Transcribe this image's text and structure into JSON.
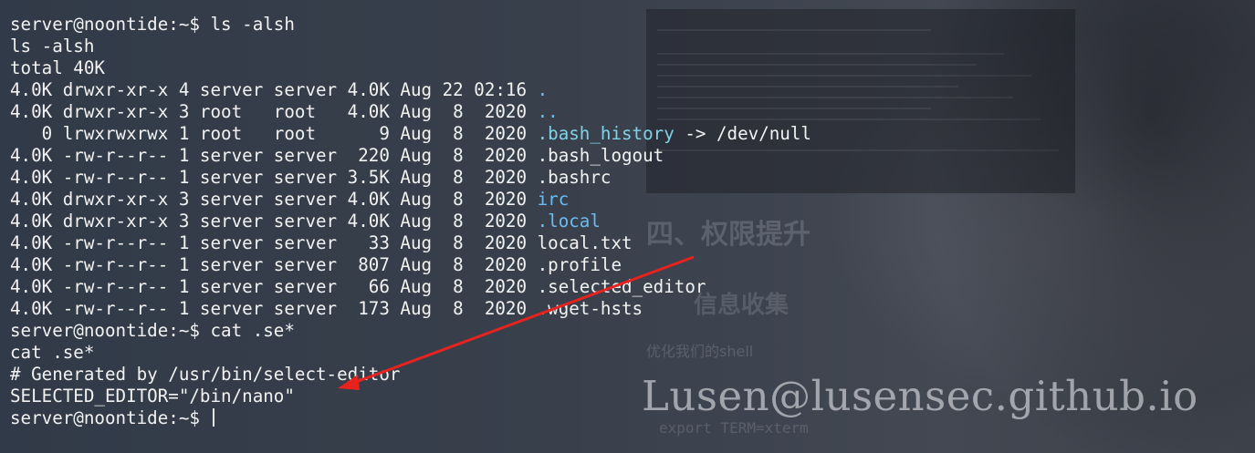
{
  "terminal": {
    "lines": [
      {
        "segments": [
          {
            "text": "server@noontide:~$ ls -alsh",
            "kind": "plain"
          }
        ]
      },
      {
        "segments": [
          {
            "text": "ls -alsh",
            "kind": "plain"
          }
        ]
      },
      {
        "segments": [
          {
            "text": "total 40K",
            "kind": "plain"
          }
        ]
      },
      {
        "segments": [
          {
            "text": "4.0K drwxr-xr-x 4 server server 4.0K Aug 22 02:16 ",
            "kind": "plain"
          },
          {
            "text": ".",
            "kind": "dir"
          }
        ]
      },
      {
        "segments": [
          {
            "text": "4.0K drwxr-xr-x 3 root   root   4.0K Aug  8  2020 ",
            "kind": "plain"
          },
          {
            "text": "..",
            "kind": "dir"
          }
        ]
      },
      {
        "segments": [
          {
            "text": "   0 lrwxrwxrwx 1 root   root      9 Aug  8  2020 ",
            "kind": "plain"
          },
          {
            "text": ".bash_history",
            "kind": "link"
          },
          {
            "text": " -> /dev/null",
            "kind": "plain"
          }
        ]
      },
      {
        "segments": [
          {
            "text": "4.0K -rw-r--r-- 1 server server  220 Aug  8  2020 .bash_logout",
            "kind": "plain"
          }
        ]
      },
      {
        "segments": [
          {
            "text": "4.0K -rw-r--r-- 1 server server 3.5K Aug  8  2020 .bashrc",
            "kind": "plain"
          }
        ]
      },
      {
        "segments": [
          {
            "text": "4.0K drwxr-xr-x 3 server server 4.0K Aug  8  2020 ",
            "kind": "plain"
          },
          {
            "text": "irc",
            "kind": "dir"
          }
        ]
      },
      {
        "segments": [
          {
            "text": "4.0K drwxr-xr-x 3 server server 4.0K Aug  8  2020 ",
            "kind": "plain"
          },
          {
            "text": ".local",
            "kind": "dir"
          }
        ]
      },
      {
        "segments": [
          {
            "text": "4.0K -rw-r--r-- 1 server server   33 Aug  8  2020 local.txt",
            "kind": "plain"
          }
        ]
      },
      {
        "segments": [
          {
            "text": "4.0K -rw-r--r-- 1 server server  807 Aug  8  2020 .profile",
            "kind": "plain"
          }
        ]
      },
      {
        "segments": [
          {
            "text": "4.0K -rw-r--r-- 1 server server   66 Aug  8  2020 .selected_editor",
            "kind": "plain"
          }
        ]
      },
      {
        "segments": [
          {
            "text": "4.0K -rw-r--r-- 1 server server  173 Aug  8  2020 .wget-hsts",
            "kind": "plain"
          }
        ]
      },
      {
        "segments": [
          {
            "text": "server@noontide:~$ cat .se*",
            "kind": "plain"
          }
        ]
      },
      {
        "segments": [
          {
            "text": "cat .se*",
            "kind": "plain"
          }
        ]
      },
      {
        "segments": [
          {
            "text": "# Generated by /usr/bin/select-editor",
            "kind": "plain"
          }
        ]
      },
      {
        "segments": [
          {
            "text": "SELECTED_EDITOR=\"/bin/nano\"",
            "kind": "plain"
          }
        ]
      },
      {
        "segments": [
          {
            "text": "server@noontide:~$ ",
            "kind": "plain"
          }
        ],
        "cursor": true
      }
    ]
  },
  "background": {
    "heading": "四、权限提升",
    "subheading": "信息收集",
    "small_text": "优化我们的shell",
    "code_text": "export TERM=xterm"
  },
  "watermark": "Lusen@lusensec.github.io",
  "colors": {
    "directory": "#6bbcf2",
    "symlink": "#7fd3e8",
    "text": "#f2f2f2",
    "annotation_arrow": "#e8231e"
  },
  "annotation": {
    "type": "arrow",
    "points_to": "SELECTED_EDITOR line"
  }
}
